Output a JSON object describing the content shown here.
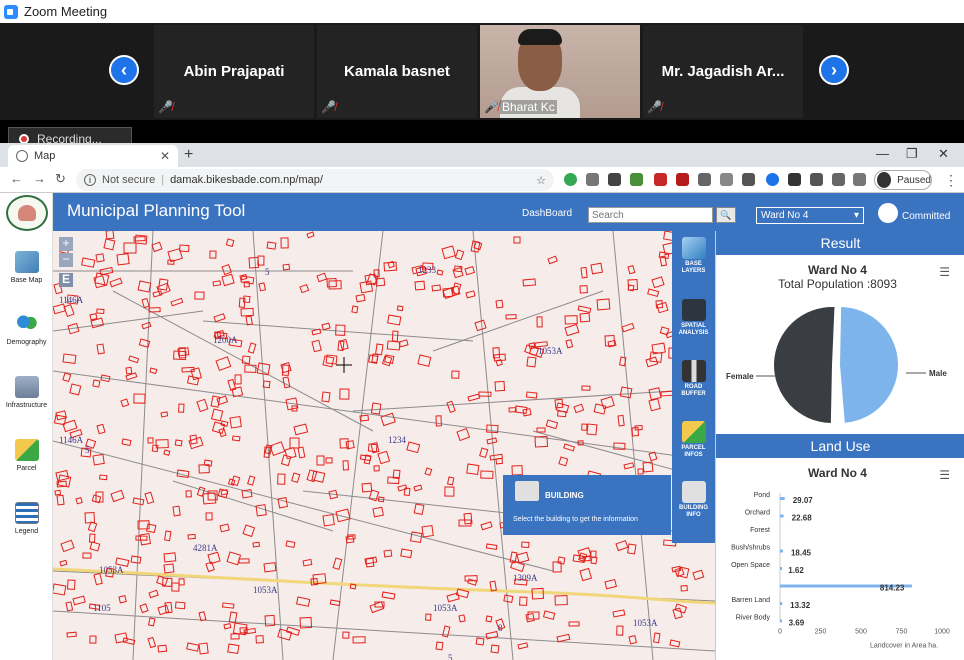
{
  "zoom": {
    "window_title": "Zoom Meeting",
    "participants": [
      {
        "name": "Abin Prajapati",
        "muted": true
      },
      {
        "name": "Kamala basnet",
        "muted": true
      },
      {
        "name": "Bharat Kc",
        "muted": true,
        "video": true
      },
      {
        "name": "Mr. Jagadish Ar...",
        "muted": true
      }
    ],
    "recording_label": "Recording..."
  },
  "browser": {
    "tab_title": "Map",
    "security_label": "Not secure",
    "url": "damak.bikesbade.com.np/map/",
    "profile_status": "Paused"
  },
  "app": {
    "title": "Municipal Planning Tool",
    "dashboard_link": "DashBoard",
    "search_placeholder": "Search",
    "ward_selected": "Ward No 4",
    "user_name": "Committed"
  },
  "left_nav": [
    {
      "label": "Base Map",
      "icon": "layers-icon"
    },
    {
      "label": "Demography",
      "icon": "people-icon"
    },
    {
      "label": "Infrastructure",
      "icon": "buildings-icon"
    },
    {
      "label": "Parcel",
      "icon": "flag-icon"
    },
    {
      "label": "Legend",
      "icon": "legend-icon"
    }
  ],
  "map_controls": {
    "zoom_in": "+",
    "zoom_out": "−",
    "extent": "E"
  },
  "tools": [
    {
      "label_1": "BASE",
      "label_2": "LAYERS"
    },
    {
      "label_1": "SPATIAL",
      "label_2": "ANALYSIS"
    },
    {
      "label_1": "ROAD",
      "label_2": "BUFFER"
    },
    {
      "label_1": "PARCEL",
      "label_2": "INFOS"
    },
    {
      "label_1": "BUILDING",
      "label_2": "INFO"
    }
  ],
  "building_popup": {
    "title": "BUILDING",
    "description": "Select the building to get the information"
  },
  "map_labels": [
    {
      "text": "5"
    },
    {
      "text": "1233"
    },
    {
      "text": "1146A"
    },
    {
      "text": "1200A"
    },
    {
      "text": "1053A"
    },
    {
      "text": "1146A"
    },
    {
      "text": "5"
    },
    {
      "text": "1053A"
    },
    {
      "text": "1053A"
    },
    {
      "text": "1053A"
    },
    {
      "text": "1053A"
    },
    {
      "text": "8"
    },
    {
      "text": "1105"
    },
    {
      "text": "1234"
    },
    {
      "text": "4281A"
    },
    {
      "text": "1309A"
    },
    {
      "text": "5"
    }
  ],
  "result": {
    "header": "Result",
    "title": "Ward No 4",
    "population_label": "Total Population :8093",
    "chart_data": {
      "type": "pie",
      "categories": [
        "Female",
        "Male"
      ],
      "values": [
        51,
        49
      ],
      "colors": [
        "#3a3d42",
        "#7eb4ec"
      ]
    }
  },
  "land_use": {
    "header": "Land Use",
    "title": "Ward No 4",
    "chart_data": {
      "type": "bar",
      "orientation": "horizontal",
      "categories": [
        "Pond",
        "Orchard",
        "Forest",
        "Bush/shrubs",
        "Open Space",
        "Barren Land",
        "River Body"
      ],
      "values": [
        29.07,
        22.68,
        null,
        18.45,
        1.62,
        814.23,
        13.32,
        3.69
      ],
      "labels": [
        "29.07",
        "22.68",
        "18.45",
        "1.62",
        "814.23",
        "13.32",
        "3.69"
      ],
      "xlim": [
        0,
        1000
      ],
      "xticks": [
        "0",
        "250",
        "500",
        "750",
        "1000"
      ],
      "xlabel": "Landcover in Area ha."
    }
  }
}
